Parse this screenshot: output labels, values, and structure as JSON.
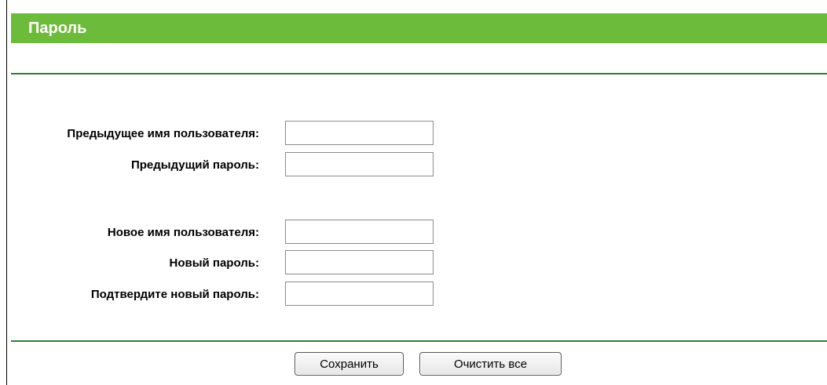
{
  "header": {
    "title": "Пароль"
  },
  "form": {
    "old_username": {
      "label": "Предыдущее имя пользователя:",
      "value": ""
    },
    "old_password": {
      "label": "Предыдущий пароль:",
      "value": ""
    },
    "new_username": {
      "label": "Новое имя пользователя:",
      "value": ""
    },
    "new_password": {
      "label": "Новый пароль:",
      "value": ""
    },
    "confirm_password": {
      "label": "Подтвердите новый пароль:",
      "value": ""
    }
  },
  "buttons": {
    "save_label": "Сохранить",
    "clear_label": "Очистить все"
  },
  "colors": {
    "header_bg": "#6cbb3a",
    "divider": "#2f7d32",
    "header_text": "#ffffff"
  }
}
